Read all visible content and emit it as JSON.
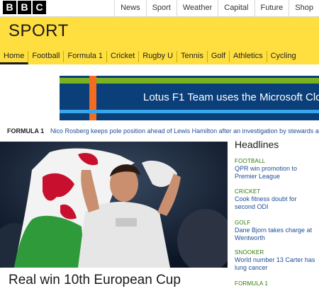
{
  "top_nav": {
    "logo_letters": [
      "B",
      "B",
      "C"
    ],
    "items": [
      "News",
      "Sport",
      "Weather",
      "Capital",
      "Future",
      "Shop"
    ]
  },
  "masthead": {
    "title": "SPORT"
  },
  "sport_nav": {
    "items": [
      "Home",
      "Football",
      "Formula 1",
      "Cricket",
      "Rugby U",
      "Tennis",
      "Golf",
      "Athletics",
      "Cycling"
    ],
    "active": "Home"
  },
  "banner": {
    "text": "Lotus F1 Team uses the Microsoft Clo"
  },
  "ticker": {
    "label": "FORMULA 1",
    "text": "Nico Rosberg keeps pole position ahead of Lewis Hamilton after an investigation by stewards at"
  },
  "hero": {
    "caption": "Real win 10th European Cup"
  },
  "headlines": {
    "title": "Headlines",
    "items": [
      {
        "category": "FOOTBALL",
        "title": "QPR win promotion to Premier League"
      },
      {
        "category": "CRICKET",
        "title": "Cook fitness doubt for second ODI"
      },
      {
        "category": "GOLF",
        "title": "Dane Bjorn takes charge at Wentworth"
      },
      {
        "category": "SNOOKER",
        "title": "World number 13 Carter has lung cancer"
      },
      {
        "category": "FORMULA 1",
        "title": ""
      }
    ]
  },
  "colors": {
    "masthead_yellow": "#ffdf3f",
    "link_blue": "#1f4e96",
    "category_green": "#2d7a00"
  }
}
